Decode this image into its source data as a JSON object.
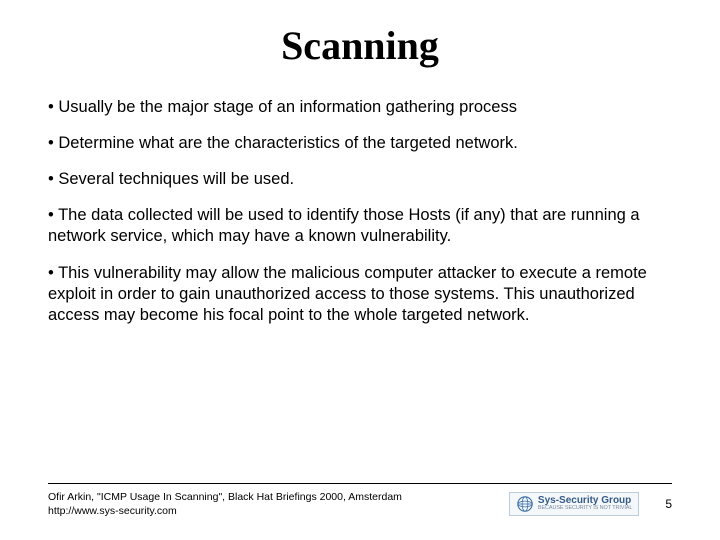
{
  "title": "Scanning",
  "bullets": [
    "Usually be the major stage of an information gathering process",
    "Determine what are the characteristics of the targeted network.",
    "Several techniques will be used.",
    "The data collected will be used to identify those Hosts (if any) that are running a network service, which may have a known vulnerability.",
    "This vulnerability may allow the malicious computer attacker to execute a remote exploit in order to gain unauthorized access to those systems. This unauthorized access may become his focal point to the whole targeted network."
  ],
  "footer": {
    "citation": "Ofir Arkin, \"ICMP Usage In Scanning\", Black Hat Briefings 2000, Amsterdam",
    "url": "http://www.sys-security.com",
    "logo_title": "Sys-Security Group",
    "logo_sub": "BECAUSE SECURITY IS NOT TRIVIAL",
    "page": "5"
  }
}
